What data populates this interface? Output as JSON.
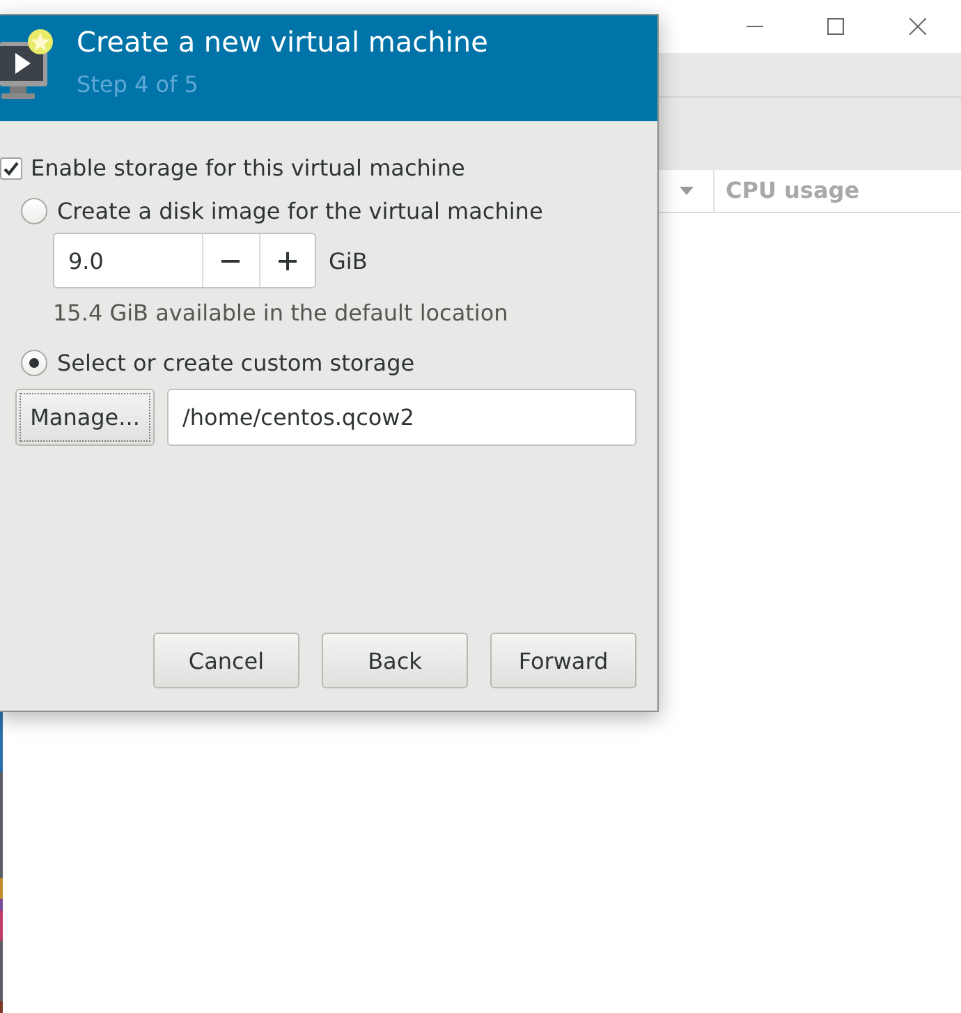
{
  "main_window": {
    "table": {
      "columns": [
        {
          "label": "CPU usage"
        }
      ]
    }
  },
  "dialog": {
    "title": "Create a new virtual machine",
    "subtitle": "Step 4 of 5",
    "enable_storage": {
      "label": "Enable storage for this virtual machine",
      "checked": true
    },
    "storage_options": [
      {
        "kind": "disk_image",
        "label": "Create a disk image for the virtual machine",
        "selected": false,
        "size": {
          "value": "9.0",
          "unit": "GiB"
        },
        "note": "15.4 GiB available in the default location"
      },
      {
        "kind": "custom",
        "label": "Select or create custom storage",
        "selected": true,
        "manage_button": "Manage...",
        "path": {
          "value": "/home/centos.qcow2"
        }
      }
    ],
    "buttons": [
      {
        "label": "Cancel"
      },
      {
        "label": "Back"
      },
      {
        "label": "Forward"
      }
    ]
  }
}
